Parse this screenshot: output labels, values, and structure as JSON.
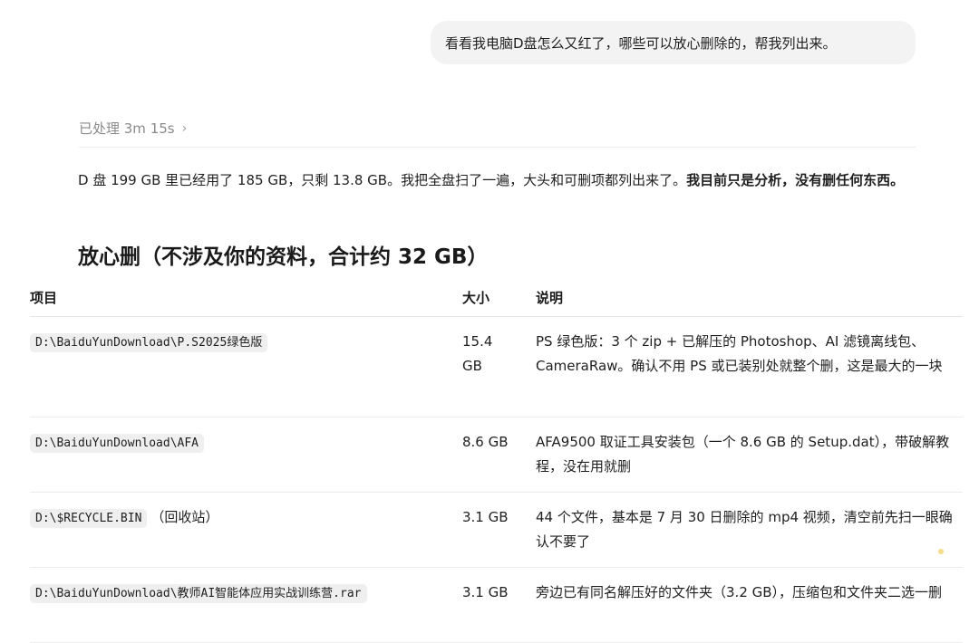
{
  "user_message": "看看我电脑D盘怎么又红了，哪些可以放心删除的，帮我列出来。",
  "status": {
    "label": "已处理 3m 15s",
    "chevron_icon": "chevron-right-icon"
  },
  "summary": {
    "text": "D 盘 199 GB 里已经用了 185 GB，只剩 13.8 GB。我把全盘扫了一遍，大头和可删项都列出来了。",
    "bold": "我目前只是分析，没有删任何东西。"
  },
  "section_title": "放心删（不涉及你的资料，合计约 32 GB）",
  "table": {
    "headers": {
      "item": "项目",
      "size": "大小",
      "desc": "说明"
    },
    "rows": [
      {
        "path": "D:\\BaiduYunDownload\\P.S2025绿色版",
        "suffix": "",
        "size": "15.4 GB",
        "desc": "PS 绿色版：3 个 zip + 已解压的 Photoshop、AI 滤镜离线包、CameraRaw。确认不用 PS 或已装别处就整个删，这是最大的一块"
      },
      {
        "path": "D:\\BaiduYunDownload\\AFA",
        "suffix": "",
        "size": "8.6 GB",
        "desc": "AFA9500 取证工具安装包（一个 8.6 GB 的 Setup.dat），带破解教程，没在用就删"
      },
      {
        "path": "D:\\$RECYCLE.BIN",
        "suffix": "（回收站）",
        "size": "3.1 GB",
        "desc": "44 个文件，基本是 7 月 30 日删除的 mp4 视频，清空前先扫一眼确认不要了"
      },
      {
        "path": "D:\\BaiduYunDownload\\教师AI智能体应用实战训练营.rar",
        "suffix": "",
        "size": "3.1 GB",
        "desc": "旁边已有同名解压好的文件夹（3.2 GB），压缩包和文件夹二选一删"
      }
    ]
  }
}
